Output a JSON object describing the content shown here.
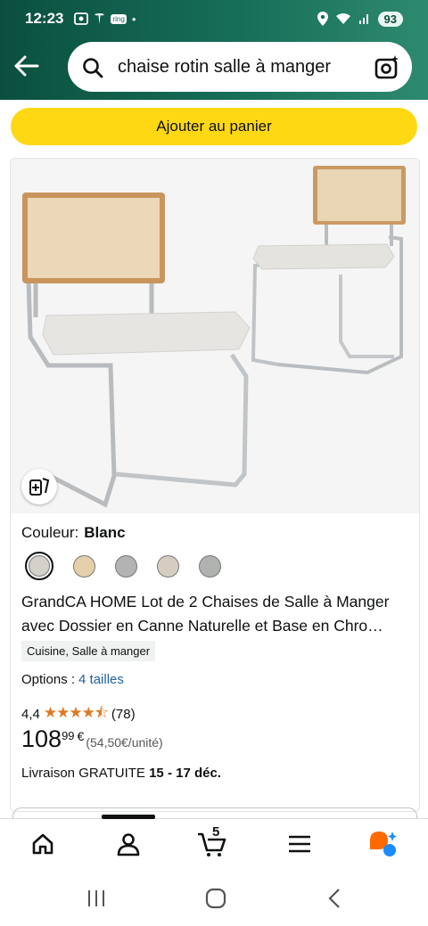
{
  "status_bar": {
    "time": "12:23",
    "notif_text": "ring",
    "battery": "93"
  },
  "search": {
    "query": "chaise rotin salle à manger"
  },
  "add_to_cart": {
    "label": "Ajouter au panier"
  },
  "product": {
    "color_label": "Couleur:",
    "color_value": "Blanc",
    "swatches": [
      "#d4d0ca",
      "#e6d0ab",
      "#b3b3b3",
      "#d6ccc0",
      "#b0b2b0"
    ],
    "title_line1": "GrandCA HOME Lot de 2 Chaises de Salle à Manger",
    "title_line2": "avec Dossier en Canne Naturelle et Base en Chro…",
    "category_tag": "Cuisine, Salle à manger",
    "options_label": "Options :",
    "options_link": "4 tailles",
    "rating": "4,4",
    "rating_stars": 4.4,
    "review_count": "(78)",
    "price_whole": "108",
    "price_fraction": "99",
    "price_currency": "€",
    "unit_price": "(54,50€/unité)",
    "delivery_prefix": "Livraison GRATUITE",
    "delivery_dates": "15 - 17 déc."
  },
  "bottom_nav": {
    "cart_count": "5"
  },
  "colors": {
    "header": "#166e58",
    "cart_button": "#ffd814",
    "link": "#2162a1",
    "stars": "#de7921"
  }
}
